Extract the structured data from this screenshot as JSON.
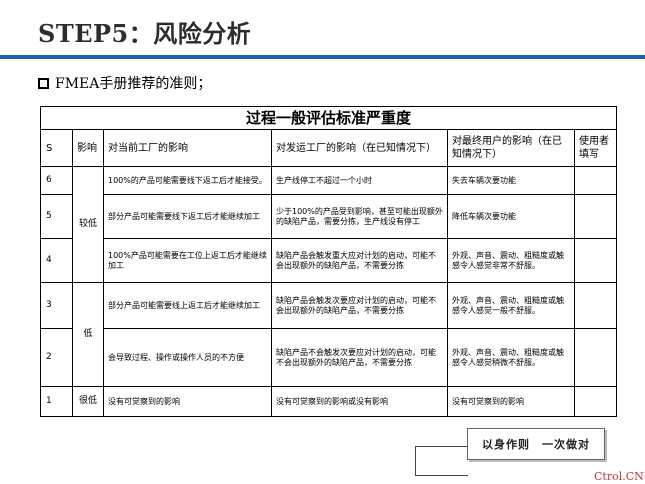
{
  "slide": {
    "title": "STEP5：风险分析",
    "bullet": "FMEA手册推荐的准则；"
  },
  "table": {
    "caption": "过程一般评估标准严重度",
    "headers": {
      "s": "S",
      "effect": "影响",
      "plant": "对当前工厂的影响",
      "ship": "对发运工厂的影响（在已知情况下）",
      "user": "对最终用户的影响（在已知情况下）",
      "filled_by": "使用者填写"
    },
    "rows": [
      {
        "s": "6",
        "effect": "",
        "plant": "100%的产品可能需要线下返工后才能接受。",
        "ship": "生产线停工不超过一个小时",
        "user": "失去车辆次要功能",
        "filled_by": ""
      },
      {
        "s": "5",
        "effect": "较低",
        "plant": "部分产品可能需要线下返工后才能继续加工",
        "ship": "少于100%的产品受到影响，甚至可能出现额外的缺陷产品，需要分拣，生产线没有停工",
        "user": "降低车辆次要功能",
        "filled_by": ""
      },
      {
        "s": "4",
        "effect": "",
        "plant": "100%产品可能需要在工位上返工后才能继续加工",
        "ship": "缺陷产品会触发重大应对计划的启动，可能不会出现额外的缺陷产品，不需要分拣",
        "user": "外观、声音、震动、粗糙度或触感令人感觉非常不舒服。",
        "filled_by": ""
      },
      {
        "s": "3",
        "effect": "低",
        "plant": "部分产品可能需要线上返工后才能继续加工",
        "ship": "缺陷产品会触发次要应对计划的启动，可能不会出现额外的缺陷产品，不需要分拣",
        "user": "外观、声音、震动、粗糙度或触感令人感觉一般不舒服。",
        "filled_by": ""
      },
      {
        "s": "2",
        "effect": "",
        "plant": "会导致过程、操作或操作人员的不方便",
        "ship": "缺陷产品不会触发次要应对计划的启动，可能不会出现额外的缺陷产品，不需要分拣",
        "user": "外观、声音、震动、粗糙度或触感令人感觉稍微不舒服。",
        "filled_by": ""
      },
      {
        "s": "1",
        "effect": "很低",
        "plant": "没有可觉察到的影响",
        "ship": "没有可觉察到的影响或没有影响",
        "user": "没有可觉察到的影响",
        "filled_by": ""
      }
    ]
  },
  "slogan": "以身作则　一次做对",
  "watermark": "Ctrol.CN"
}
